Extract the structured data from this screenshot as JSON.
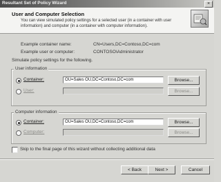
{
  "window": {
    "title": "Resultant Set of Policy Wizard",
    "close_glyph": "×"
  },
  "header": {
    "title": "User and Computer Selection",
    "description": "You can view simulated policy settings for a selected user (in a container with user information) and computer (in a container with computer information).",
    "icon": "wizard-icon"
  },
  "info": {
    "container_label": "Example container name:",
    "container_value": "CN=Users,DC=Contoso,DC=com",
    "user_label": "Example user or computer:",
    "user_value": "CONTOSO\\Administrator"
  },
  "simulate_text": "Simulate policy settings for the following.",
  "user_info": {
    "group_label": "User information",
    "container_option": "Container:",
    "container_value": "OU=Sales OU,DC=Contoso,DC=com",
    "user_option": "User:",
    "browse_label": "Browse..."
  },
  "computer_info": {
    "group_label": "Computer information",
    "container_option": "Container:",
    "container_value": "OU=Sales OU,DC=Contoso,DC=com",
    "computer_option": "Computer:",
    "browse_label": "Browse..."
  },
  "skip_checkbox": "Skip to the final page of this wizard without collecting additional data",
  "footer": {
    "back_label": "< Back",
    "next_label": "Next >",
    "cancel_label": "Cancel"
  }
}
